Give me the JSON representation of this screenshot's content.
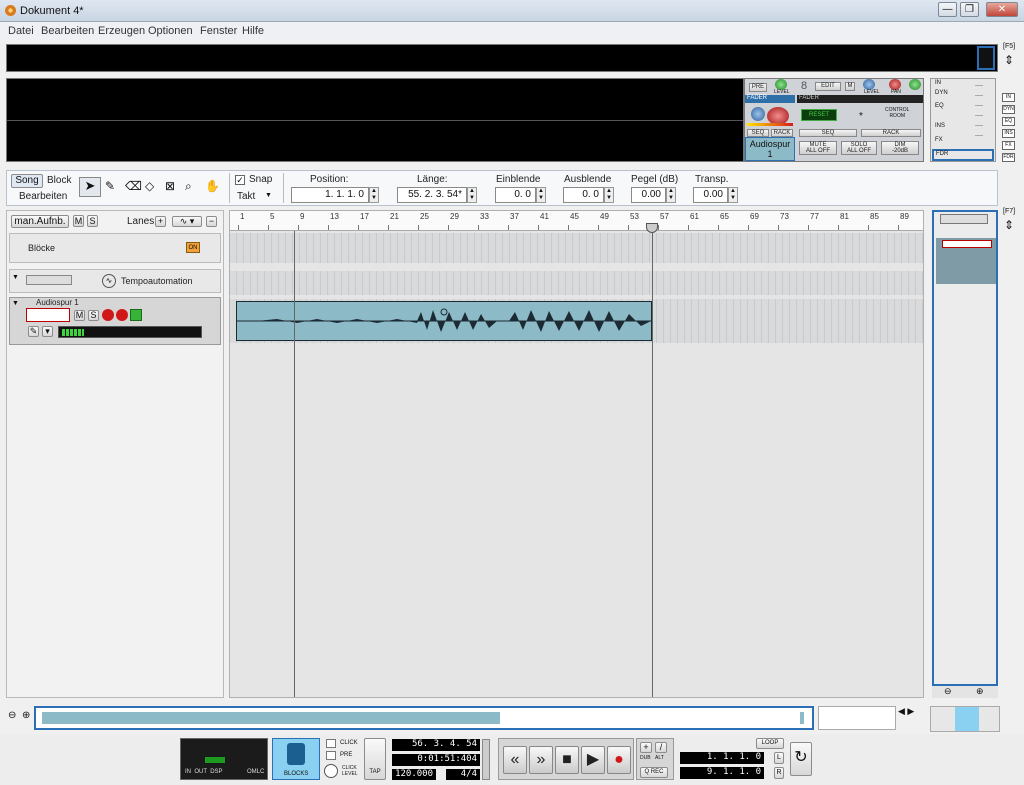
{
  "window": {
    "title": "Dokument 4*",
    "buttons": [
      "—",
      "❐",
      "✕"
    ]
  },
  "menu": [
    "Datei",
    "Bearbeiten",
    "Erzeugen",
    "Optionen",
    "Fenster",
    "Hilfe"
  ],
  "top_side": {
    "f5_label": "[F5]",
    "f7_label": "[F7]"
  },
  "mixer": {
    "pre": "PRE",
    "level": "LEVEL",
    "pan": "PAN",
    "fader": "FADER",
    "fader2": "FADER",
    "edit": "EDIT",
    "m": "M",
    "number": "8",
    "reset": "RESET",
    "control_room": "CONTROL\nROOM",
    "seq": "SEQ",
    "rack": "RACK",
    "seq2": "SEQ",
    "rack2": "RACK",
    "channel_name": "Audiospur 1",
    "mute_all": "MUTE\nALL OFF",
    "solo_all": "SOLO\nALL OFF",
    "dim": "DIM\n-20dB"
  },
  "inspector_tabs": [
    "IN",
    "DYN",
    "EQ",
    "INS",
    "FX",
    "FDR"
  ],
  "inspector_side_tabs": [
    "IN",
    "DYN",
    "EQ",
    "INS",
    "FX",
    "FDR"
  ],
  "toolbar": {
    "song": "Song",
    "block": "Block",
    "bearbeiten": "Bearbeiten",
    "snap": "Snap",
    "takt": "Takt",
    "position_label": "Position:",
    "position_value": "1. 1. 1. 0",
    "laenge_label": "Länge:",
    "laenge_value": "55. 2. 3. 54*",
    "einblende_label": "Einblende",
    "einblende_value": "0. 0",
    "ausblende_label": "Ausblende",
    "ausblende_value": "0. 0",
    "pegel_label": "Pegel (dB)",
    "pegel_value": "0.00",
    "transp_label": "Transp.",
    "transp_value": "0.00"
  },
  "track_header": {
    "man_aufnb": "man.Aufnb.",
    "m": "M",
    "s": "S",
    "lanes": "Lanes",
    "bloecke": "Blöcke",
    "on": "ON",
    "tempoautomation": "Tempoautomation",
    "audiospur": "Audiospur 1",
    "track_m": "M",
    "track_s": "S"
  },
  "ruler_marks": [
    "1",
    "5",
    "9",
    "13",
    "17",
    "21",
    "25",
    "29",
    "33",
    "37",
    "41",
    "45",
    "49",
    "53",
    "57",
    "61",
    "65",
    "69",
    "73",
    "77",
    "81",
    "85",
    "89"
  ],
  "transport": {
    "click": "CLICK",
    "pre": "PRE",
    "click_level": "CLICK\nLEVEL",
    "tap": "TAP",
    "blocks": "BLOCKS",
    "meter_labels": "IN  OUT  DSP",
    "omlc": "OMLC",
    "pos_bars": "56. 3. 4. 54",
    "pos_time": "0:01:51:404",
    "tempo": "120.000",
    "signature": "4/4",
    "dub": "DUB",
    "alt": "ALT",
    "q_rec": "Q REC",
    "loop": "LOOP",
    "loop_start": "1. 1. 1. 0",
    "loop_end": "9. 1. 1. 0",
    "l": "L",
    "r": "R"
  },
  "colors": {
    "accent": "#2d6fb5",
    "audio_block": "#8cbac7",
    "waveform": "#1c2b33",
    "record": "#d11818"
  }
}
